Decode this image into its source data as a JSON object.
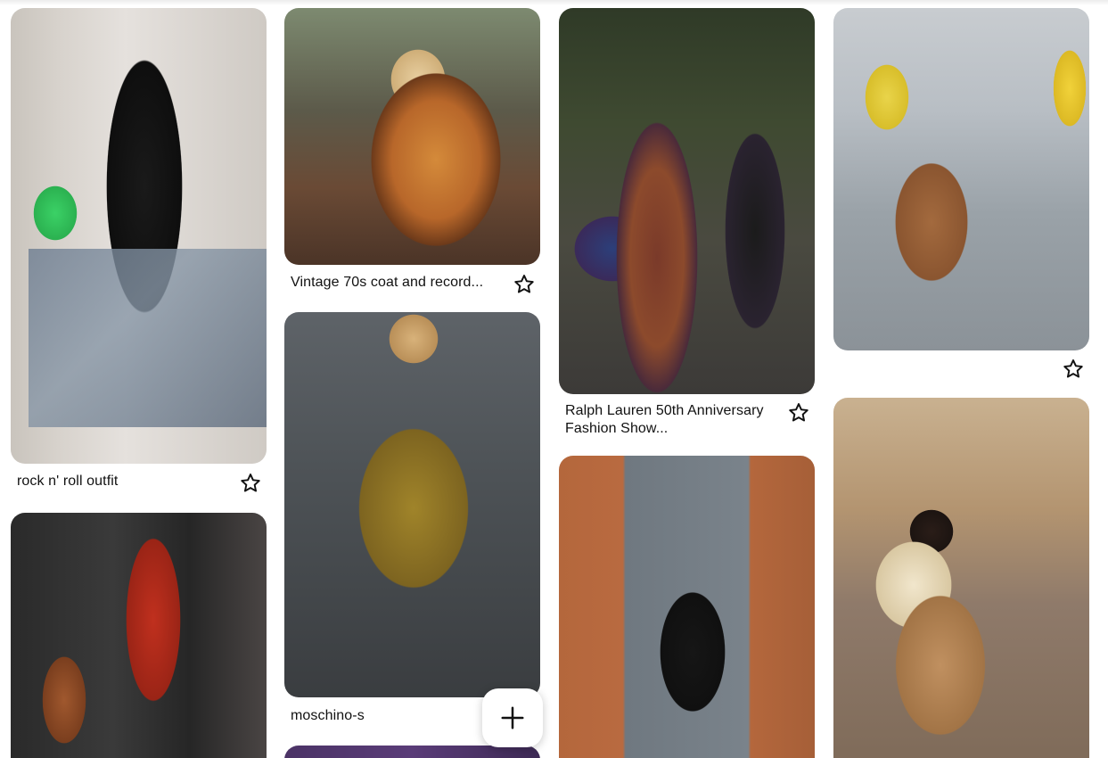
{
  "pins": [
    {
      "id": "a",
      "caption": "rock n' roll outfit",
      "alt": "rock-outfit-photo"
    },
    {
      "id": "b",
      "caption": "Vintage 70s coat and record...",
      "alt": "vintage-coat-photo"
    },
    {
      "id": "c",
      "caption": "Ralph Lauren 50th Anniversary Fashion Show...",
      "alt": "ralph-lauren-show-photo"
    },
    {
      "id": "d",
      "caption": "",
      "alt": "fur-coat-street-photo"
    },
    {
      "id": "e",
      "caption": "",
      "alt": "guitar-velvet-pants-photo"
    },
    {
      "id": "f",
      "caption": "moschino-s",
      "alt": "moschino-runway-photo"
    },
    {
      "id": "g",
      "caption": "",
      "alt": "misfits-tee-photo"
    },
    {
      "id": "h",
      "caption": "",
      "alt": "fur-collar-car-photo"
    },
    {
      "id": "i",
      "caption": "",
      "alt": "partial-next-pin-photo"
    }
  ],
  "icons": {
    "save": "star-icon",
    "create": "plus-icon"
  },
  "colors": {
    "background": "#ffffff",
    "text": "#111111"
  }
}
